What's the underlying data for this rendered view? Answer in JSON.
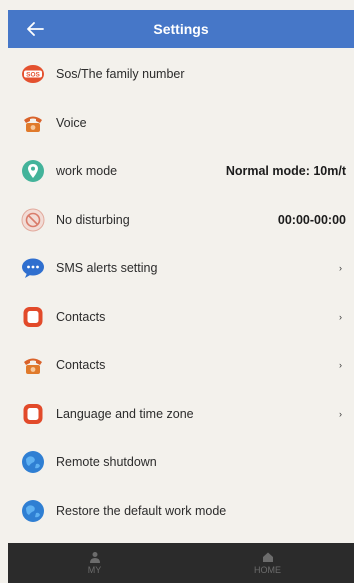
{
  "header": {
    "title": "Settings",
    "back_icon": "arrow-left-icon"
  },
  "items": [
    {
      "label": "Sos/The family number",
      "icon": "sos-icon",
      "value": "",
      "arrow": ""
    },
    {
      "label": "Voice",
      "icon": "phone-icon",
      "value": "",
      "arrow": ""
    },
    {
      "label": "work mode",
      "icon": "location-pin-icon",
      "value": "Normal mode: 10m/t",
      "arrow": ""
    },
    {
      "label": "No disturbing",
      "icon": "do-not-disturb-icon",
      "value": "00:00-00:00",
      "arrow": ""
    },
    {
      "label": "SMS alerts setting",
      "icon": "chat-bubble-icon",
      "value": "",
      "arrow": "›"
    },
    {
      "label": "Contacts",
      "icon": "contacts-book-icon",
      "value": "",
      "arrow": "›"
    },
    {
      "label": "Contacts",
      "icon": "phone-icon",
      "value": "",
      "arrow": "›"
    },
    {
      "label": "Language and time zone",
      "icon": "contacts-book-icon",
      "value": "",
      "arrow": "›"
    },
    {
      "label": "Remote shutdown",
      "icon": "globe-icon",
      "value": "",
      "arrow": ""
    },
    {
      "label": "Restore the default work mode",
      "icon": "globe-icon",
      "value": "",
      "arrow": ""
    }
  ],
  "tabs": [
    {
      "label": "MY",
      "icon": "person-icon"
    },
    {
      "label": "HOME",
      "icon": "home-icon"
    }
  ],
  "colors": {
    "header": "#4677c8",
    "tabbar": "#2b2b2b",
    "sos": "#e4512f",
    "phone": "#e07a2b",
    "pin": "#43b39a",
    "bubble": "#2f6fcf",
    "book": "#e24a2a",
    "globe": "#2f7fd3"
  }
}
